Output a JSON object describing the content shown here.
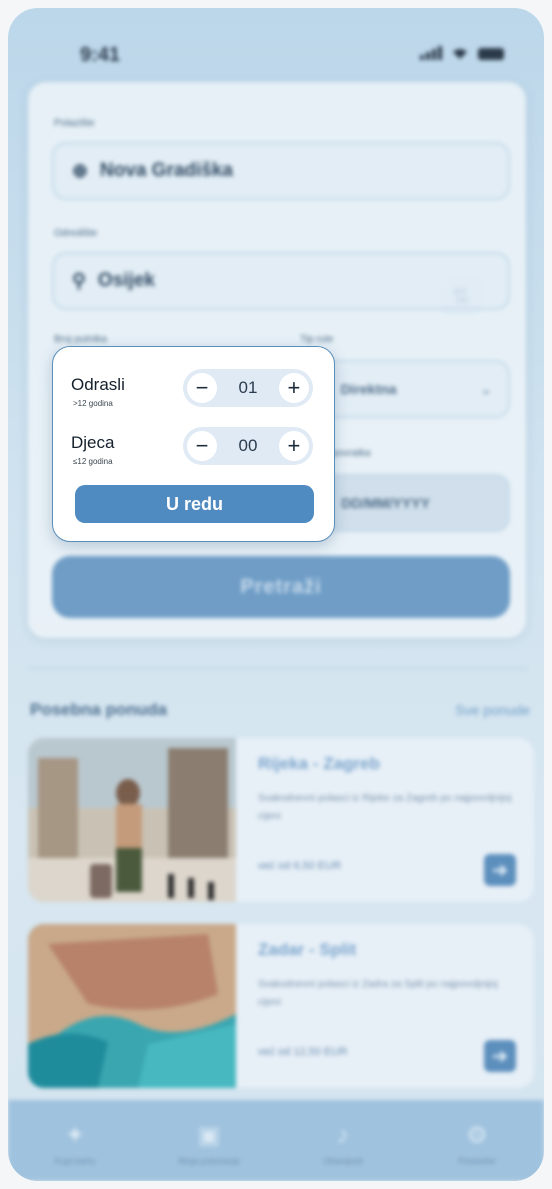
{
  "status_bar": {
    "time": "9:41"
  },
  "form": {
    "from_label": "Polazište",
    "from_value": "Nova Gradiška",
    "to_label": "Odredište",
    "to_value": "Osijek",
    "passengers_label": "Broj putnika",
    "route_type_label": "Tip rute",
    "route_type_value": "Direktna",
    "return_date_label": "Datum povratka",
    "return_date_placeholder": "DD/MM/YYYY",
    "search_label": "Pretraži"
  },
  "popup": {
    "adults_label": "Odrasli",
    "adults_sub": ">12 godina",
    "adults_value": "01",
    "children_label": "Djeca",
    "children_sub": "≤12 godina",
    "children_value": "00",
    "minus": "−",
    "plus": "+",
    "ok_label": "U redu"
  },
  "offers": {
    "title": "Posebna ponuda",
    "see_all": "Sve ponude",
    "items": [
      {
        "route": "Rijeka - Zagreb",
        "desc": "Svakodnevni polasci iz Rijeke za Zagreb po najpovoljnijoj cijeni",
        "price": "već od 6,50 EUR"
      },
      {
        "route": "Zadar - Split",
        "desc": "Svakodnevni polasci iz Zadra za Split po najpovoljnijoj cijeni",
        "price": "već od 12,50 EUR"
      }
    ]
  },
  "tabbar": {
    "items": [
      {
        "label": "Kupi kartu",
        "icon": "ticket-icon"
      },
      {
        "label": "Moja putovanja",
        "icon": "bus-icon"
      },
      {
        "label": "Obavijesti",
        "icon": "bell-icon"
      },
      {
        "label": "Postavke",
        "icon": "gear-icon"
      }
    ]
  },
  "colors": {
    "accent": "#4f8ac0",
    "popup_border": "#5a8fba"
  }
}
